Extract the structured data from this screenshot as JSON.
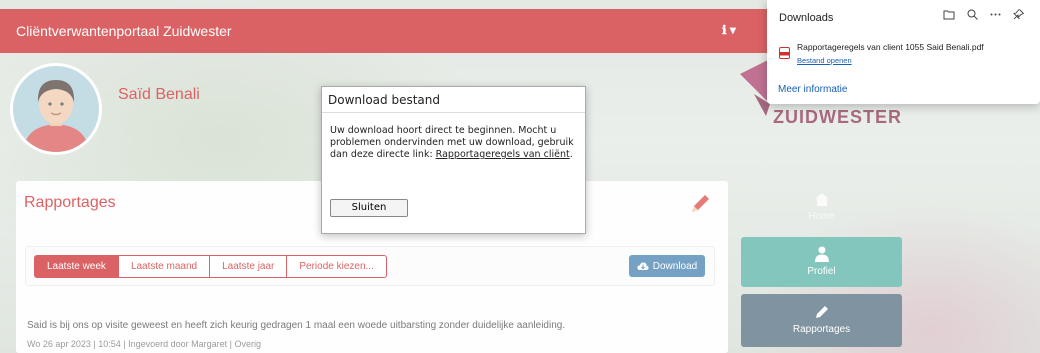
{
  "app": {
    "title": "Cliëntverwantenportaal Zuidwester",
    "info_menu": "ℹ ▾"
  },
  "profile": {
    "name": "Saïd Benali"
  },
  "logo": {
    "text": "ZUIDWESTER"
  },
  "rapportages": {
    "title": "Rapportages",
    "tabs": [
      {
        "label": "Laatste week",
        "active": true
      },
      {
        "label": "Laatste maand",
        "active": false
      },
      {
        "label": "Laatste jaar",
        "active": false
      },
      {
        "label": "Periode kiezen...",
        "active": false
      }
    ],
    "download_label": "Download",
    "entry": {
      "text": "Said is bij ons op visite geweest en heeft zich keurig gedragen 1 maal een woede uitbarsting zonder duidelijke aanleiding.",
      "meta": "Wo 26 apr 2023 | 10:54 | Ingevoerd door Margaret | Overig"
    }
  },
  "sidebar": {
    "items": [
      {
        "label": "Home",
        "icon": "home-icon"
      },
      {
        "label": "Profiel",
        "icon": "user-icon"
      },
      {
        "label": "Rapportages",
        "icon": "pencil-icon"
      }
    ]
  },
  "modal": {
    "title": "Download bestand",
    "body_text": "Uw download hoort direct te beginnen. Mocht u problemen ondervinden met uw download, gebruik dan deze directe link: ",
    "link_text": "Rapportageregels van cliënt",
    "close_label": "Sluiten"
  },
  "downloads_panel": {
    "title": "Downloads",
    "file_name": "Rapportageregels van client 1055 Said Benali.pdf",
    "open_label": "Bestand openen",
    "more_info": "Meer informatie"
  },
  "colors": {
    "brand_red": "#c80e12",
    "teal": "#3fa89a",
    "slate": "#3d5a6e",
    "download_blue": "#2b6fa5",
    "logo_purple": "#7a1a3c"
  }
}
